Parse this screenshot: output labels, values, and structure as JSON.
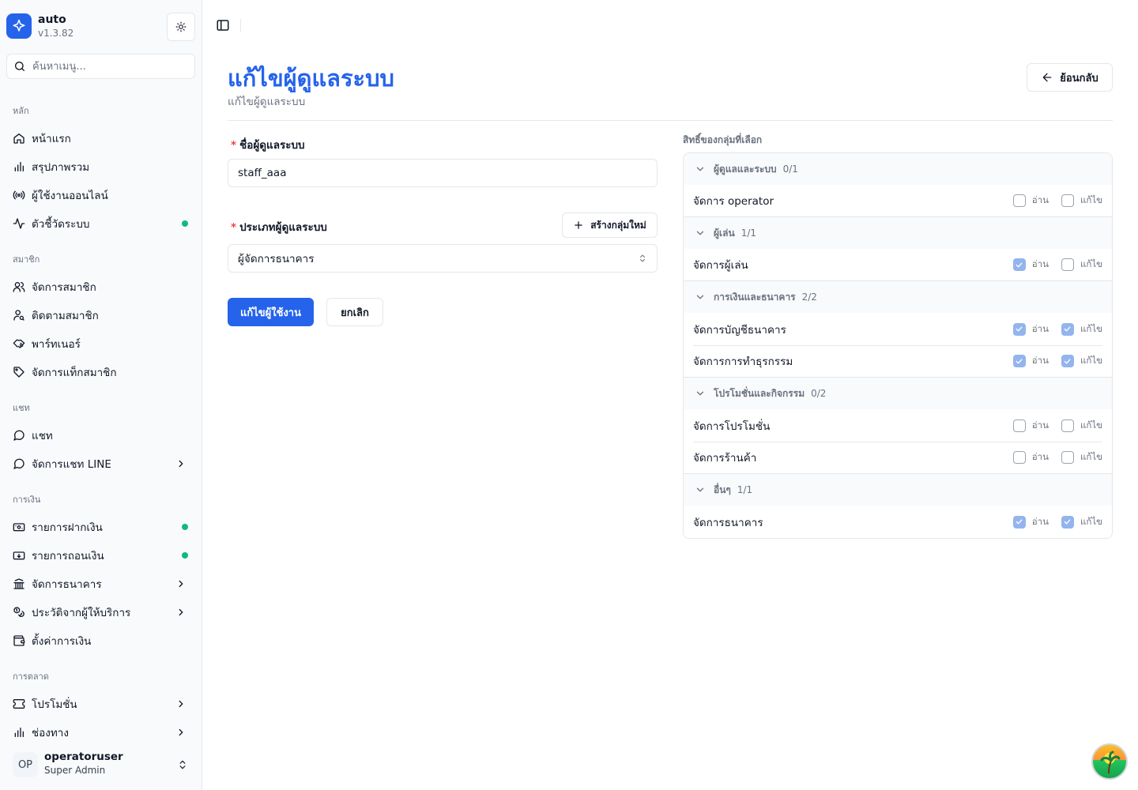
{
  "brand": {
    "name": "auto",
    "version": "v1.3.82"
  },
  "search": {
    "placeholder": "ค้นหาเมนู..."
  },
  "sidebar": {
    "sections": [
      {
        "title": "หลัก",
        "items": [
          {
            "label": "หน้าแรก",
            "icon": "home-icon"
          },
          {
            "label": "สรุปภาพรวม",
            "icon": "bar-chart-icon"
          },
          {
            "label": "ผู้ใช้งานออนไลน์",
            "icon": "radio-icon"
          },
          {
            "label": "ตัวชี้วัดระบบ",
            "icon": "activity-icon",
            "dot": true
          }
        ]
      },
      {
        "title": "สมาชิก",
        "items": [
          {
            "label": "จัดการสมาชิก",
            "icon": "users-icon"
          },
          {
            "label": "ติดตามสมาชิก",
            "icon": "user-search-icon"
          },
          {
            "label": "พาร์ทเนอร์",
            "icon": "handshake-icon"
          },
          {
            "label": "จัดการแท็กสมาชิก",
            "icon": "tag-icon"
          }
        ]
      },
      {
        "title": "แชท",
        "items": [
          {
            "label": "แชท",
            "icon": "message-circle-icon"
          },
          {
            "label": "จัดการแชท LINE",
            "icon": "message-circle-icon",
            "chevron": true
          }
        ]
      },
      {
        "title": "การเงิน",
        "items": [
          {
            "label": "รายการฝากเงิน",
            "icon": "deposit-icon",
            "dot": true
          },
          {
            "label": "รายการถอนเงิน",
            "icon": "withdraw-icon",
            "dot": true
          },
          {
            "label": "จัดการธนาคาร",
            "icon": "bank-icon",
            "chevron": true
          },
          {
            "label": "ประวัติจากผู้ให้บริการ",
            "icon": "coins-icon",
            "chevron": true
          },
          {
            "label": "ตั้งค่าการเงิน",
            "icon": "wallet-icon"
          }
        ]
      },
      {
        "title": "การตลาด",
        "items": [
          {
            "label": "โปรโมชั่น",
            "icon": "ticket-icon",
            "chevron": true
          },
          {
            "label": "ช่องทาง",
            "icon": "bar-chart-icon",
            "chevron": true
          }
        ]
      }
    ]
  },
  "user": {
    "initials": "OP",
    "name": "operatoruser",
    "role": "Super Admin"
  },
  "header": {
    "title": "แก้ไขผู้ดูแลระบบ",
    "subtitle": "แก้ไขผู้ดูแลระบบ",
    "back_label": "ย้อนกลับ"
  },
  "form": {
    "name_label": "ชื่อผู้ดูแลระบบ",
    "name_value": "staff_aaa",
    "type_label": "ประเภทผู้ดูแลระบบ",
    "new_group_label": "สร้างกลุ่มใหม่",
    "type_value": "ผู้จัดการธนาคาร",
    "submit_label": "แก้ไขผู้ใช้งาน",
    "cancel_label": "ยกเลิก"
  },
  "permissions": {
    "title": "สิทธิ์ของกลุ่มที่เลือก",
    "read_label": "อ่าน",
    "edit_label": "แก้ไข",
    "groups": [
      {
        "name": "ผู้ดูแลและระบบ",
        "count": "0/1",
        "items": [
          {
            "name": "จัดการ operator",
            "read": false,
            "edit": false
          }
        ]
      },
      {
        "name": "ผู้เล่น",
        "count": "1/1",
        "items": [
          {
            "name": "จัดการผู้เล่น",
            "read": true,
            "edit": false
          }
        ]
      },
      {
        "name": "การเงินและธนาคาร",
        "count": "2/2",
        "items": [
          {
            "name": "จัดการบัญชีธนาคาร",
            "read": true,
            "edit": true
          },
          {
            "name": "จัดการการทำธุรกรรม",
            "read": true,
            "edit": true
          }
        ]
      },
      {
        "name": "โปรโมชั่นและกิจกรรม",
        "count": "0/2",
        "items": [
          {
            "name": "จัดการโปรโมชั่น",
            "read": false,
            "edit": false
          },
          {
            "name": "จัดการร้านค้า",
            "read": false,
            "edit": false
          }
        ]
      },
      {
        "name": "อื่นๆ",
        "count": "1/1",
        "items": [
          {
            "name": "จัดการธนาคาร",
            "read": true,
            "edit": true
          }
        ]
      }
    ]
  },
  "colors": {
    "accent": "#2563eb",
    "status_dot": "#10b981",
    "checkbox_checked": "#93b4ee"
  }
}
